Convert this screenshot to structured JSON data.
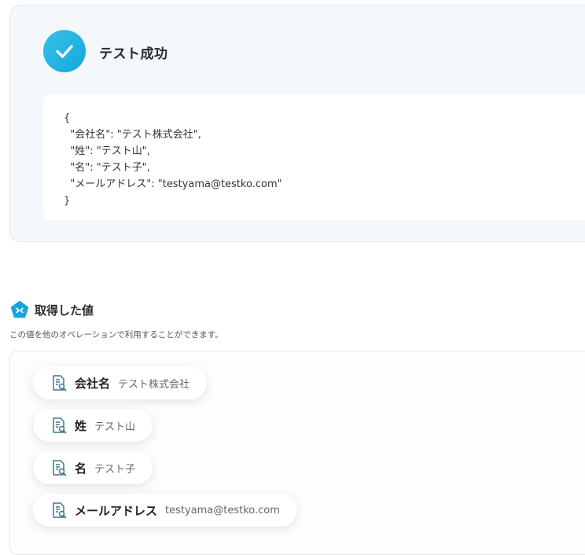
{
  "test_result": {
    "status_icon": "check-icon",
    "title": "テスト成功",
    "json_lines": [
      "{",
      "  \"会社名\": \"テスト株式会社\",",
      "  \"姓\": \"テスト山\",",
      "  \"名\": \"テスト子\",",
      "  \"メールアドレス\": \"testyama@testko.com\"",
      "}"
    ]
  },
  "acquired_values": {
    "icon": "pentagon-logo-icon",
    "title": "取得した値",
    "description": "この値を他のオペレーションで利用することができます。",
    "items": [
      {
        "icon": "document-search-icon",
        "label": "会社名",
        "value": "テスト株式会社"
      },
      {
        "icon": "document-search-icon",
        "label": "姓",
        "value": "テスト山"
      },
      {
        "icon": "document-search-icon",
        "label": "名",
        "value": "テスト子"
      },
      {
        "icon": "document-search-icon",
        "label": "メールアドレス",
        "value": "testyama@testko.com"
      }
    ]
  },
  "colors": {
    "accent": "#1aa9de",
    "panel_bg": "#f5f8fb"
  }
}
